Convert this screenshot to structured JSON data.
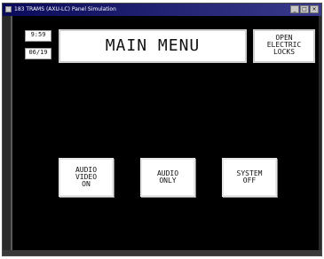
{
  "window": {
    "title": "183 TRAMS (AXU-LC) Panel Simulation",
    "controls": [
      "_",
      "□",
      "×"
    ]
  },
  "status": {
    "time": "9:59",
    "date": "06/19"
  },
  "header": {
    "title": "MAIN MENU",
    "locks_button": "OPEN\nELECTRIC\nLOCKS"
  },
  "menu": {
    "audio_video_on": "AUDIO\nVIDEO\nON",
    "audio_only": "AUDIO\nONLY",
    "system_off": "SYSTEM\nOFF"
  },
  "colors": {
    "screen_bg": "#000000",
    "button_bg": "#ffffff",
    "titlebar": "#0a0a5a"
  }
}
